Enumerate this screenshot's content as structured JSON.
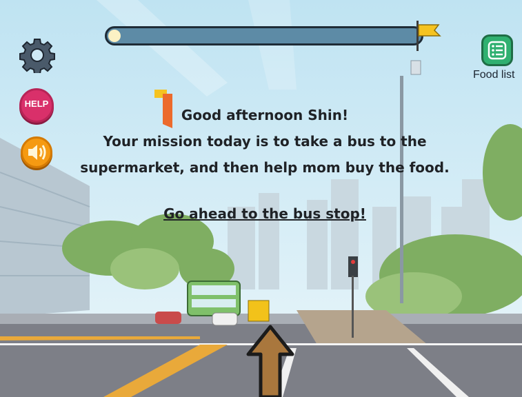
{
  "progress": {
    "value": 0.03,
    "flag_icon": "finish-flag-icon"
  },
  "buttons": {
    "settings_icon": "gear-icon",
    "help_label": "HELP",
    "sound_icon": "speaker-icon",
    "food_list_label": "Food list",
    "food_list_icon": "list-icon"
  },
  "dialog": {
    "greeting": "Good afternoon Shin!",
    "line2": "Your mission today is to take a bus to the",
    "line3": "supermarket, and then help mom buy the food.",
    "call_to_action": "Go ahead to the bus stop!"
  },
  "navigation": {
    "arrow_icon": "forward-arrow-icon"
  },
  "colors": {
    "help": "#d9306a",
    "sound": "#f59a12",
    "food_list": "#2fb070",
    "sky": "#cfe9f5",
    "track": "#5d8ba6"
  }
}
